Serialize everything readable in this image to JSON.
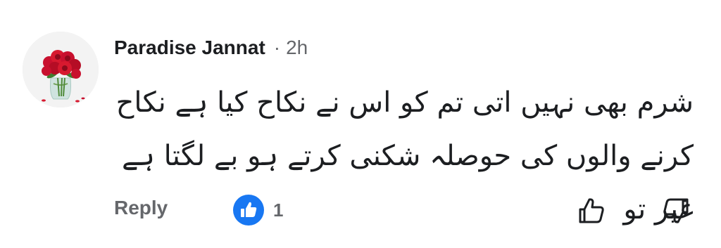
{
  "comment": {
    "author": "Paradise Jannat",
    "separator": "·",
    "time": "2h",
    "text": "شرم بھی نہیں اتی تم کو اس نے نکاح کیا ہے نکاح کرنے والوں کی حوصلہ شکنی کرتے ہو بے لگتا ہے غیر تو"
  },
  "actions": {
    "reply_label": "Reply",
    "like_count": "1",
    "like_icon": "thumbs-up-icon",
    "upvote_icon": "thumbs-up-outline-icon",
    "downvote_icon": "thumbs-down-outline-icon"
  },
  "colors": {
    "text_primary": "#1c1e21",
    "text_secondary": "#65676b",
    "like_blue": "#1877f2"
  }
}
